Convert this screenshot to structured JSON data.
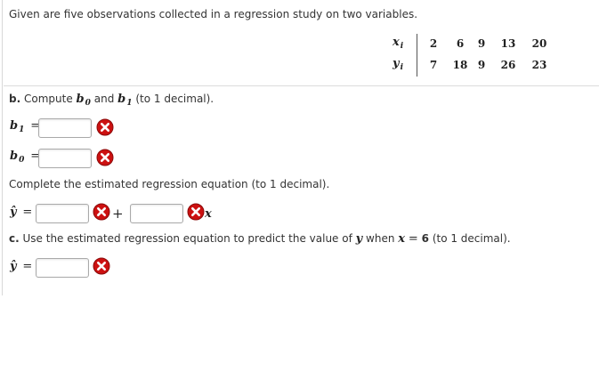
{
  "intro_text": "Given are five observations collected in a regression study on two variables.",
  "table": {
    "x_label": "x",
    "x_sub": "i",
    "y_label": "y",
    "y_sub": "i",
    "x_values": [
      "2",
      "6",
      "9",
      "13",
      "20"
    ],
    "y_values": [
      "7",
      "18",
      "9",
      "26",
      "23"
    ]
  },
  "part_b": {
    "letter": "b.",
    "prefix": "Compute",
    "b0": "b",
    "b0_sub": "0",
    "and": "and",
    "b1": "b",
    "b1_sub": "1",
    "suffix": "(to 1 decimal).",
    "b1_field_label": "b",
    "b1_field_sub": "1",
    "b0_field_label": "b",
    "b0_field_sub": "0",
    "equals": "=",
    "b1_value": "",
    "b0_value": ""
  },
  "equation": {
    "instruction": "Complete the estimated regression equation (to 1 decimal).",
    "yhat": "ŷ",
    "equals": "=",
    "plus": "+",
    "x": "x",
    "intercept_value": "",
    "slope_value": ""
  },
  "part_c": {
    "letter": "c.",
    "text_before": "Use the estimated regression equation to predict the value of",
    "y": "y",
    "when": "when",
    "x": "x",
    "equals": "=",
    "x_value": "6",
    "suffix": "(to 1 decimal).",
    "yhat": "ŷ",
    "prediction_value": ""
  },
  "colors": {
    "error_icon": "#cc1111",
    "input_border": "#a9a9a9"
  },
  "icons": [
    "incorrect-x-icon"
  ]
}
